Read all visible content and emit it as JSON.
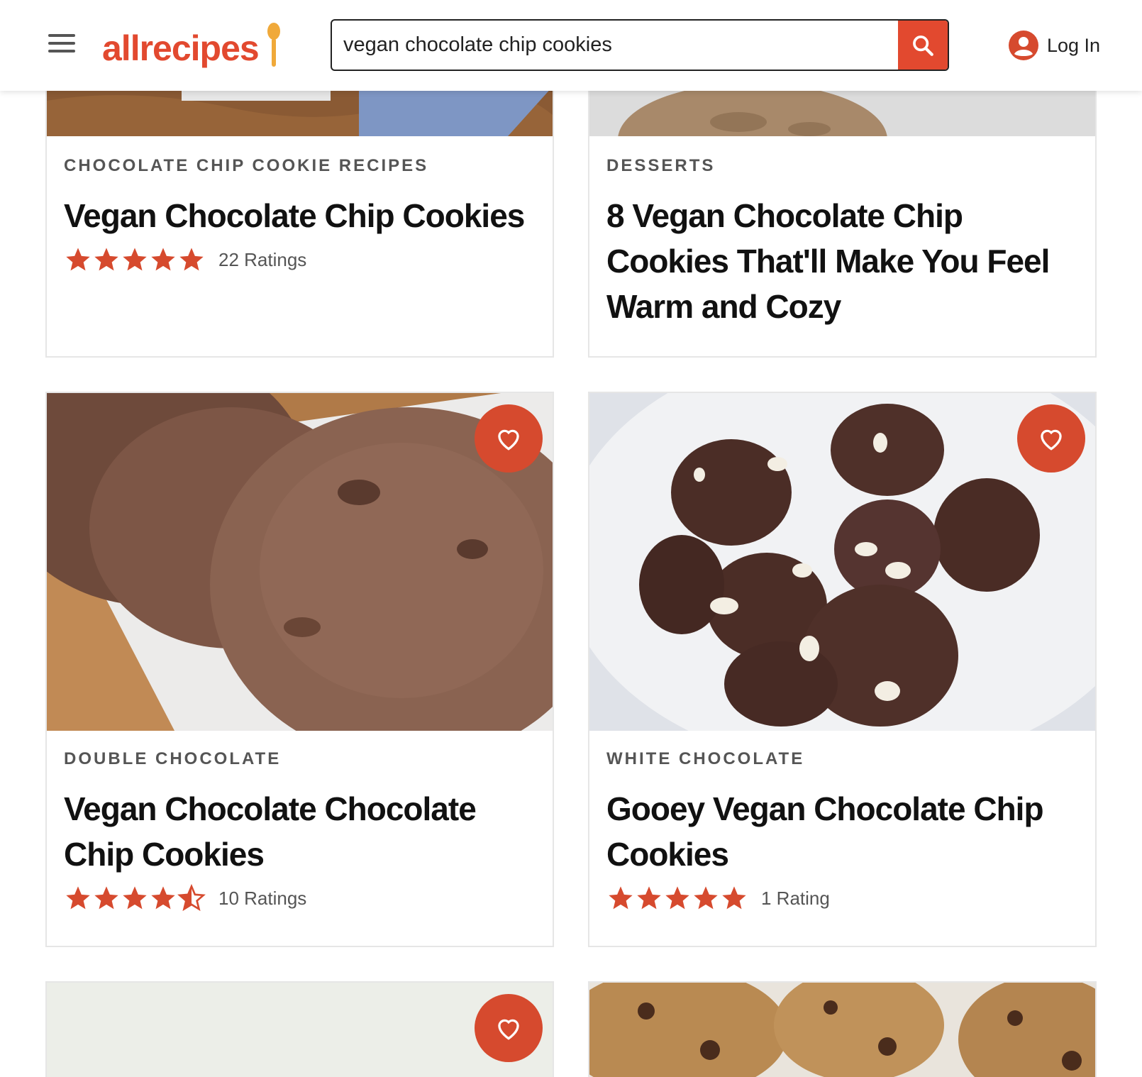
{
  "header": {
    "logo_text": "allrecipes",
    "search_value": "vegan chocolate chip cookies",
    "login_label": "Log In"
  },
  "colors": {
    "brand": "#e2492f",
    "star": "#d64a2e"
  },
  "cards": [
    {
      "tag": "CHOCOLATE CHIP COOKIE RECIPES",
      "title": "Vegan Chocolate Chip Cookies",
      "rating": 5,
      "rating_label": "22 Ratings"
    },
    {
      "tag": "DESSERTS",
      "title": "8 Vegan Chocolate Chip Cookies That'll Make You Feel Warm and Cozy"
    },
    {
      "tag": "DOUBLE CHOCOLATE",
      "title": "Vegan Chocolate Chocolate Chip Cookies",
      "rating": 4.5,
      "rating_label": "10 Ratings"
    },
    {
      "tag": "WHITE CHOCOLATE",
      "title": "Gooey Vegan Chocolate Chip Cookies",
      "rating": 5,
      "rating_label": "1 Rating"
    }
  ],
  "icons": {
    "menu": "menu-icon",
    "search": "search-icon",
    "account": "account-icon",
    "favorite": "heart-icon",
    "star": "star-icon",
    "half_star": "half-star-icon"
  }
}
